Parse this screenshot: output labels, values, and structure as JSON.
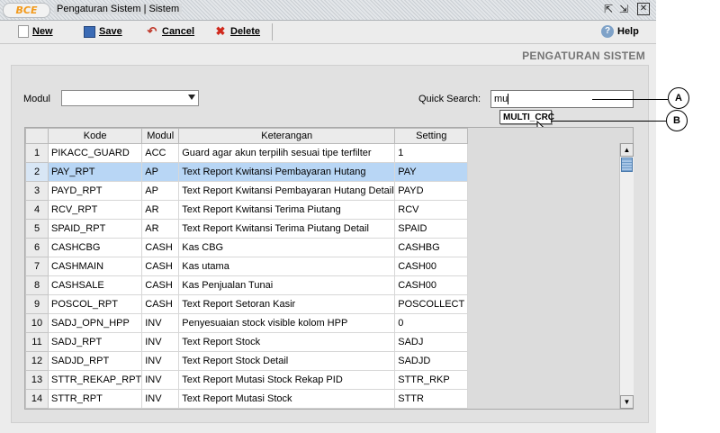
{
  "window": {
    "logo": "BCE",
    "title": "Pengaturan Sistem | Sistem",
    "controls": {
      "restore": "⇱",
      "maximize": "⇲",
      "close": "✕"
    }
  },
  "toolbar": {
    "new_label": "New",
    "save_label": "Save",
    "cancel_label": "Cancel",
    "delete_label": "Delete",
    "help_label": "Help"
  },
  "page_heading": "PENGATURAN SISTEM",
  "filters": {
    "modul_label": "Modul",
    "modul_value": "",
    "quick_search_label": "Quick Search:",
    "quick_search_value": "mu",
    "suggestion": "MULTI_CRC"
  },
  "callouts": {
    "a": "A",
    "b": "B"
  },
  "table": {
    "columns": [
      "Kode",
      "Modul",
      "Keterangan",
      "Setting"
    ],
    "selected_row": 2,
    "rows": [
      {
        "no": "1",
        "kode": "PIKACC_GUARD",
        "modul": "ACC",
        "keterangan": "Guard agar akun terpilih sesuai tipe terfilter",
        "setting": "1"
      },
      {
        "no": "2",
        "kode": "PAY_RPT",
        "modul": "AP",
        "keterangan": "Text Report Kwitansi Pembayaran Hutang",
        "setting": "PAY"
      },
      {
        "no": "3",
        "kode": "PAYD_RPT",
        "modul": "AP",
        "keterangan": "Text Report Kwitansi Pembayaran Hutang Detail",
        "setting": "PAYD"
      },
      {
        "no": "4",
        "kode": "RCV_RPT",
        "modul": "AR",
        "keterangan": "Text Report Kwitansi Terima Piutang",
        "setting": "RCV"
      },
      {
        "no": "5",
        "kode": "SPAID_RPT",
        "modul": "AR",
        "keterangan": "Text Report Kwitansi Terima Piutang Detail",
        "setting": "SPAID"
      },
      {
        "no": "6",
        "kode": "CASHCBG",
        "modul": "CASH",
        "keterangan": "Kas CBG",
        "setting": "CASHBG"
      },
      {
        "no": "7",
        "kode": "CASHMAIN",
        "modul": "CASH",
        "keterangan": "Kas utama",
        "setting": "CASH00"
      },
      {
        "no": "8",
        "kode": "CASHSALE",
        "modul": "CASH",
        "keterangan": "Kas Penjualan Tunai",
        "setting": "CASH00"
      },
      {
        "no": "9",
        "kode": "POSCOL_RPT",
        "modul": "CASH",
        "keterangan": "Text Report Setoran Kasir",
        "setting": "POSCOLLECT"
      },
      {
        "no": "10",
        "kode": "SADJ_OPN_HPP",
        "modul": "INV",
        "keterangan": "Penyesuaian stock visible kolom HPP",
        "setting": "0"
      },
      {
        "no": "11",
        "kode": "SADJ_RPT",
        "modul": "INV",
        "keterangan": "Text Report Stock",
        "setting": "SADJ"
      },
      {
        "no": "12",
        "kode": "SADJD_RPT",
        "modul": "INV",
        "keterangan": "Text Report Stock Detail",
        "setting": "SADJD"
      },
      {
        "no": "13",
        "kode": "STTR_REKAP_RPT",
        "modul": "INV",
        "keterangan": "Text Report Mutasi Stock Rekap PID",
        "setting": "STTR_RKP"
      },
      {
        "no": "14",
        "kode": "STTR_RPT",
        "modul": "INV",
        "keterangan": "Text Report Mutasi Stock",
        "setting": "STTR"
      }
    ]
  },
  "colors": {
    "selected_row": "#b8d6f5",
    "logo": "#f29a1c",
    "heading": "#757575"
  }
}
